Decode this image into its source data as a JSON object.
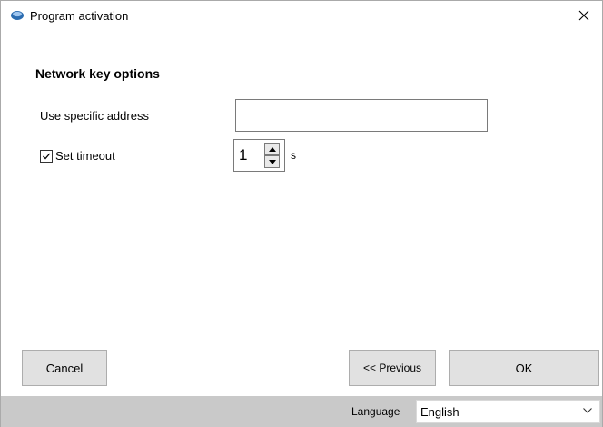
{
  "window": {
    "title": "Program activation"
  },
  "section": {
    "title": "Network key options"
  },
  "address": {
    "label": "Use specific address",
    "value": ""
  },
  "timeout": {
    "label": "Set timeout",
    "checked": true,
    "value": "1",
    "unit": "s"
  },
  "buttons": {
    "cancel": "Cancel",
    "previous": "<< Previous",
    "ok": "OK"
  },
  "language": {
    "label": "Language",
    "selected": "English"
  },
  "colors": {
    "statusbar": "#c9c9c9",
    "button": "#e1e1e1",
    "app_icon": "#2b6cb0"
  }
}
